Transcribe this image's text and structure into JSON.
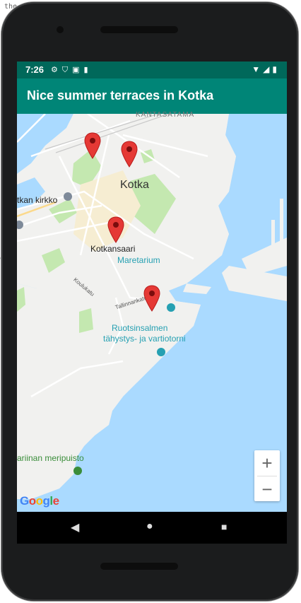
{
  "background": {
    "left_snippet_1": "the",
    "left_snippet_2": "e"
  },
  "status_bar": {
    "time": "7:26",
    "icons_left": [
      "settings-icon",
      "shield-icon",
      "image-icon",
      "sdcard-icon"
    ],
    "icons_right": [
      "wifi-icon",
      "signal-icon",
      "battery-icon"
    ]
  },
  "app_bar": {
    "title": "Nice summer terraces in Kotka"
  },
  "map": {
    "labels": {
      "kantasatama": "KANTASATAMA",
      "kotka": "Kotka",
      "kotkan_kirkko": "tkan kirkko",
      "kotkansaari": "Kotkansaari",
      "maretarium": "Maretarium",
      "koulukatu": "Koulukatu",
      "tallinnankatu": "Tallinnankatu",
      "ruotsinsalmen_1": "Ruotsinsalmen",
      "ruotsinsalmen_2": "tähystys- ja vartiotorni",
      "meripuisto": "ariinan meripuisto"
    },
    "markers": [
      "terrace-marker-1",
      "terrace-marker-2",
      "terrace-marker-3",
      "terrace-marker-4"
    ],
    "attribution": "Google",
    "zoom": {
      "in": "+",
      "out": "−"
    }
  },
  "colors": {
    "status_bar": "#00685a",
    "app_bar": "#008577",
    "water": "#aadaff",
    "land": "#f1f1ef",
    "park": "#c4e8b0",
    "marker": "#e53935"
  },
  "nav_bar": {
    "back": "◀",
    "home": "●",
    "recents": "■"
  }
}
